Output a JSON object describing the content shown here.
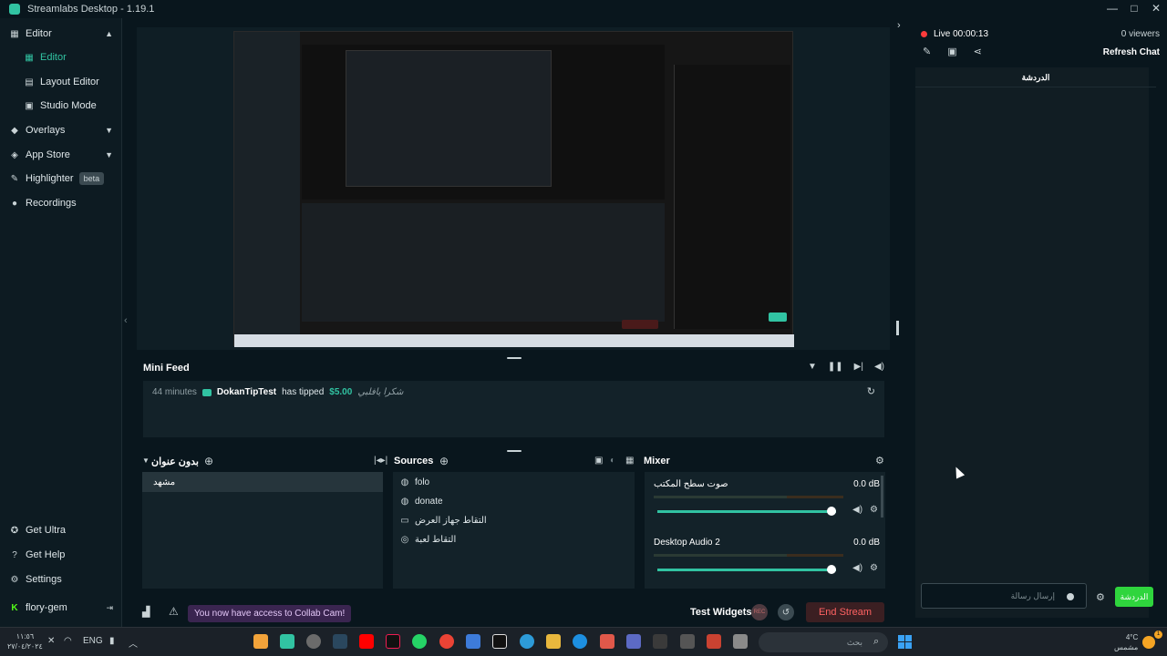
{
  "titlebar": {
    "title": "Streamlabs Desktop - 1.19.1"
  },
  "sidebar": {
    "items": [
      {
        "label": "Editor",
        "icon": "editor-icon"
      },
      {
        "label": "Editor",
        "icon": "editor-icon"
      },
      {
        "label": "Layout Editor",
        "icon": "layout-icon"
      },
      {
        "label": "Studio Mode",
        "icon": "studio-icon"
      },
      {
        "label": "Overlays",
        "icon": "overlays-icon"
      },
      {
        "label": "App Store",
        "icon": "store-icon"
      },
      {
        "label": "Highlighter",
        "icon": "highlighter-icon",
        "badge": "beta"
      },
      {
        "label": "Recordings",
        "icon": "recordings-icon"
      }
    ],
    "bottom": [
      {
        "label": "Get Ultra",
        "icon": "ultra-icon"
      },
      {
        "label": "Get Help",
        "icon": "help-icon"
      },
      {
        "label": "Settings",
        "icon": "gear-icon"
      },
      {
        "label": "flory-gem",
        "icon": "kick-icon"
      }
    ]
  },
  "minifeed": {
    "title": "Mini Feed",
    "event": {
      "time": "44 minutes",
      "user": "DokanTipTest",
      "action": "has tipped",
      "amount": "$5.00",
      "message": "شكرا يافلبي"
    }
  },
  "scenes": {
    "title": "بدون عنوان",
    "items": [
      "مشهد"
    ]
  },
  "sources": {
    "title": "Sources",
    "items": [
      {
        "label": "folo",
        "icon": "globe-icon"
      },
      {
        "label": "donate",
        "icon": "globe-icon"
      },
      {
        "label": "التقاط جهاز العرض",
        "icon": "monitor-icon"
      },
      {
        "label": "التقاط لعبة",
        "icon": "gamepad-icon"
      }
    ]
  },
  "mixer": {
    "title": "Mixer",
    "items": [
      {
        "name": "صوت سطح المكتب",
        "db": "0.0 dB"
      },
      {
        "name": "Desktop Audio 2",
        "db": "0.0 dB"
      }
    ]
  },
  "footer": {
    "alert": "You now have access to Collab Cam!",
    "test_widgets": "Test Widgets",
    "rec": "REC",
    "end_stream": "End Stream"
  },
  "chat": {
    "live": "Live 00:00:13",
    "viewers": "0 viewers",
    "refresh": "Refresh Chat",
    "header": "الدردشة",
    "placeholder": "إرسال رسالة",
    "send": "الدردشة"
  },
  "taskbar": {
    "time_a": "١١:٥٦",
    "time_b": "٢٧/٠٤/٢٠٢٤",
    "lang": "ENG",
    "search": "بحث",
    "weather_temp": "4°C",
    "weather_desc": "مشمس",
    "notif_count": "1"
  },
  "colors": {
    "accent": "#31c3a2",
    "danger": "#ff6262",
    "live": "#ff3b3b",
    "chat_send": "#2fd53d"
  }
}
